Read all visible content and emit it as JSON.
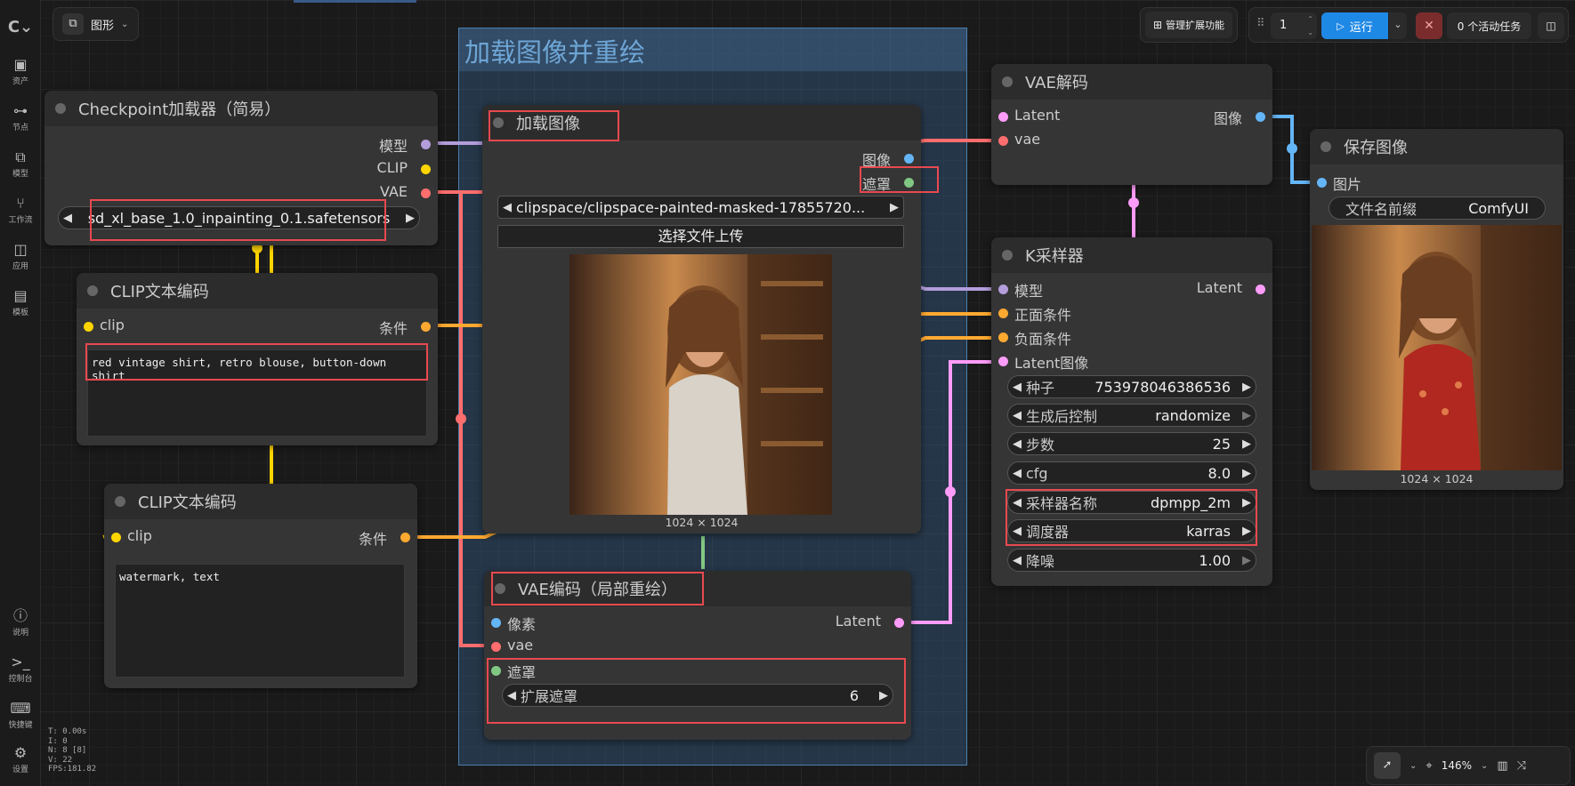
{
  "topbar": {
    "graph_tab_label": "图形",
    "manage_extensions_label": "管理扩展功能",
    "queue_count": "1",
    "run_label": "运行",
    "active_tasks_label": "0 个活动任务"
  },
  "sidebar": {
    "items": [
      {
        "label": "资产",
        "icon": "image-icon"
      },
      {
        "label": "节点",
        "icon": "node-icon"
      },
      {
        "label": "模型",
        "icon": "model-icon"
      },
      {
        "label": "工作流",
        "icon": "workflow-icon"
      },
      {
        "label": "应用",
        "icon": "app-icon"
      },
      {
        "label": "模板",
        "icon": "template-icon"
      }
    ],
    "bottom_items": [
      {
        "label": "说明",
        "icon": "help-icon"
      },
      {
        "label": "控制台",
        "icon": "console-icon"
      },
      {
        "label": "快捷键",
        "icon": "keyboard-icon"
      },
      {
        "label": "设置",
        "icon": "gear-icon"
      }
    ]
  },
  "stats": [
    "T: 0.00s",
    "I: 0",
    "N: 8 [8]",
    "V: 22",
    "FPS:181.82"
  ],
  "group": {
    "title": "加载图像并重绘"
  },
  "nodes": {
    "checkpoint": {
      "title": "Checkpoint加载器（简易）",
      "outputs": [
        "模型",
        "CLIP",
        "VAE"
      ],
      "ckpt_name": "sd_xl_base_1.0_inpainting_0.1.safetensors"
    },
    "clip_pos": {
      "title": "CLIP文本编码",
      "input": "clip",
      "output": "条件",
      "text": "red vintage shirt, retro blouse, button-down shirt"
    },
    "clip_neg": {
      "title": "CLIP文本编码",
      "input": "clip",
      "output": "条件",
      "text": "watermark, text"
    },
    "load_image": {
      "title": "加载图像",
      "outputs": [
        "图像",
        "遮罩"
      ],
      "image_path": "clipspace/clipspace-painted-masked-17855720...",
      "upload_label": "选择文件上传",
      "size": "1024 × 1024"
    },
    "vae_encode": {
      "title": "VAE编码（局部重绘）",
      "inputs": [
        "像素",
        "vae",
        "遮罩"
      ],
      "output": "Latent",
      "grow_mask_label": "扩展遮罩",
      "grow_mask_value": "6"
    },
    "vae_decode": {
      "title": "VAE解码",
      "inputs": [
        "Latent",
        "vae"
      ],
      "output": "图像"
    },
    "ksampler": {
      "title": "K采样器",
      "inputs": [
        "模型",
        "正面条件",
        "负面条件",
        "Latent图像"
      ],
      "output": "Latent",
      "widgets": [
        {
          "label": "种子",
          "value": "753978046386536"
        },
        {
          "label": "生成后控制",
          "value": "randomize"
        },
        {
          "label": "步数",
          "value": "25"
        },
        {
          "label": "cfg",
          "value": "8.0"
        },
        {
          "label": "采样器名称",
          "value": "dpmpp_2m"
        },
        {
          "label": "调度器",
          "value": "karras"
        },
        {
          "label": "降噪",
          "value": "1.00"
        }
      ]
    },
    "save_image": {
      "title": "保存图像",
      "input": "图片",
      "prefix_label": "文件名前缀",
      "prefix_value": "ComfyUI",
      "size": "1024 × 1024"
    }
  },
  "bottombar": {
    "zoom": "146%"
  },
  "colors": {
    "model": "#b39ddb",
    "clip": "#ffd500",
    "vae": "#ff6e6e",
    "image": "#64b5f6",
    "mask": "#81c784",
    "latent": "#ff9cf9",
    "conditioning": "#ffa931",
    "highlight": "#e8494f",
    "run": "#1e88e5"
  }
}
